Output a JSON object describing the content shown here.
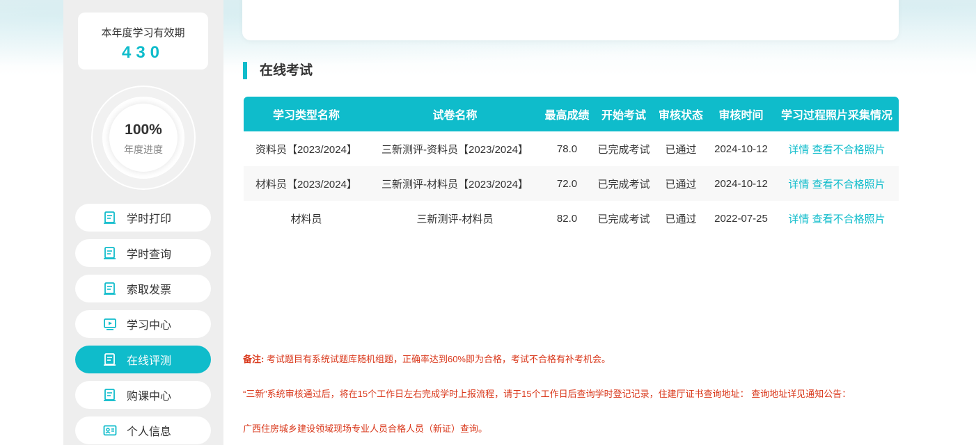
{
  "sidebar": {
    "validity_label": "本年度学习有效期",
    "validity_value": "430",
    "progress_value": "100%",
    "progress_label": "年度进度",
    "progress_fraction": 1.0,
    "nav": [
      {
        "label": "学时打印",
        "icon": "document-icon",
        "active": false
      },
      {
        "label": "学时查询",
        "icon": "document-icon",
        "active": false
      },
      {
        "label": "索取发票",
        "icon": "document-icon",
        "active": false
      },
      {
        "label": "学习中心",
        "icon": "video-play-icon",
        "active": false
      },
      {
        "label": "在线评测",
        "icon": "document-icon",
        "active": true
      },
      {
        "label": "购课中心",
        "icon": "document-icon",
        "active": false
      },
      {
        "label": "个人信息",
        "icon": "id-card-icon",
        "active": false
      }
    ]
  },
  "section": {
    "title": "在线考试"
  },
  "table": {
    "headers": [
      "学习类型名称",
      "试卷名称",
      "最高成绩",
      "开始考试",
      "审核状态",
      "审核时间",
      "学习过程照片采集情况"
    ],
    "rows": [
      {
        "type": "资料员【2023/2024】",
        "paper": "三新测评-资料员【2023/2024】",
        "score": "78.0",
        "start": "已完成考试",
        "status": "已通过",
        "time": "2024-10-12",
        "detail": "详情",
        "photo": "查看不合格照片"
      },
      {
        "type": "材料员【2023/2024】",
        "paper": "三新测评-材料员【2023/2024】",
        "score": "72.0",
        "start": "已完成考试",
        "status": "已通过",
        "time": "2024-10-12",
        "detail": "详情",
        "photo": "查看不合格照片"
      },
      {
        "type": "材料员",
        "paper": "三新测评-材料员",
        "score": "82.0",
        "start": "已完成考试",
        "status": "已通过",
        "time": "2022-07-25",
        "detail": "详情",
        "photo": "查看不合格照片"
      }
    ]
  },
  "notes": {
    "label": "备注:",
    "line1": "考试题目有系统试题库随机组题，正确率达到60%即为合格，考试不合格有补考机会。",
    "line2": "“三新”系统审核通过后，将在15个工作日左右完成学时上报流程，请于15个工作日后查询学时登记记录，住建厅证书查询地址： 查询地址详见通知公告：",
    "line3": "广西住房城乡建设领域现场专业人员合格人员（新证）查询。"
  },
  "colors": {
    "accent": "#0fbccb",
    "note": "#d9371a"
  }
}
